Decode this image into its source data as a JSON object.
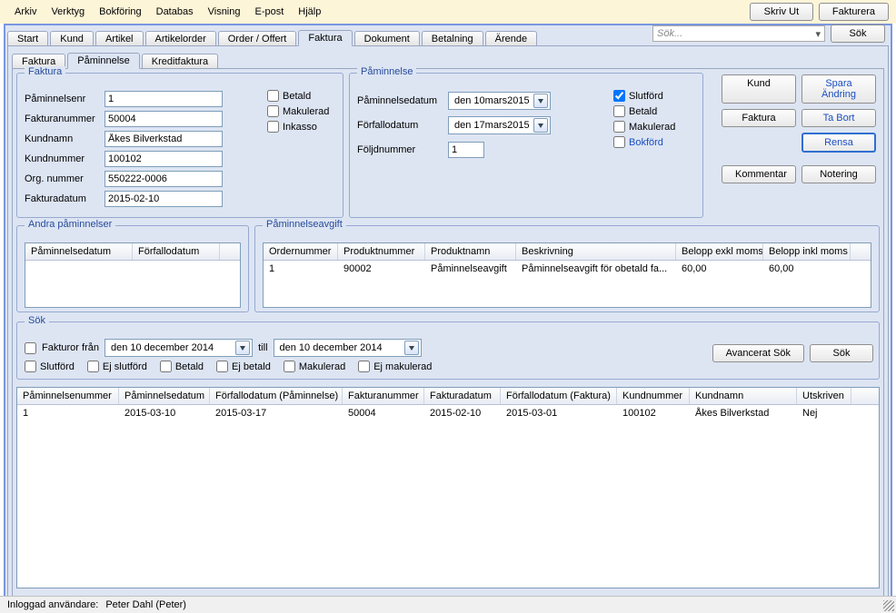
{
  "menu": [
    "Arkiv",
    "Verktyg",
    "Bokföring",
    "Databas",
    "Visning",
    "E-post",
    "Hjälp"
  ],
  "topButtons": {
    "print": "Skriv Ut",
    "invoice": "Fakturera"
  },
  "search": {
    "placeholder": "Sök...",
    "btn": "Sök"
  },
  "mainTabs": [
    "Start",
    "Kund",
    "Artikel",
    "Artikelorder",
    "Order / Offert",
    "Faktura",
    "Dokument",
    "Betalning",
    "Ärende"
  ],
  "mainActive": 5,
  "subTabs": [
    "Faktura",
    "Påminnelse",
    "Kreditfaktura"
  ],
  "subActive": 1,
  "fakturaGroup": {
    "title": "Faktura",
    "rows": {
      "paminnelseNr": {
        "lbl": "Påminnelsenr",
        "val": "1"
      },
      "fakturaNr": {
        "lbl": "Fakturanummer",
        "val": "50004"
      },
      "kundnamn": {
        "lbl": "Kundnamn",
        "val": "Åkes Bilverkstad"
      },
      "kundnummer": {
        "lbl": "Kundnummer",
        "val": "100102"
      },
      "orgnr": {
        "lbl": "Org. nummer",
        "val": "550222-0006"
      },
      "fakturadatum": {
        "lbl": "Fakturadatum",
        "val": "2015-02-10"
      }
    },
    "checks": {
      "betald": "Betald",
      "makulerad": "Makulerad",
      "inkasso": "Inkasso"
    }
  },
  "paminnelseGroup": {
    "title": "Påminnelse",
    "paminnelsedatum": {
      "lbl": "Påminnelsedatum",
      "d": "den 10",
      "m": "mars",
      "y": "2015"
    },
    "forfallodatum": {
      "lbl": "Förfallodatum",
      "d": "den 17",
      "m": "mars",
      "y": "2015"
    },
    "foljdnummer": {
      "lbl": "Följdnummer",
      "val": "1"
    },
    "checks": {
      "slutford": "Slutförd",
      "betald": "Betald",
      "makulerad": "Makulerad",
      "bokford": "Bokförd"
    },
    "checked": {
      "slutford": true
    }
  },
  "sideButtons": {
    "kund": "Kund",
    "sparaAndring": "Spara Ändring",
    "faktura": "Faktura",
    "taBort": "Ta Bort",
    "rensa": "Rensa",
    "kommentar": "Kommentar",
    "notering": "Notering"
  },
  "andra": {
    "title": "Andra påminnelser",
    "cols": [
      "Påminnelsedatum",
      "Förfallodatum"
    ]
  },
  "avgift": {
    "title": "Påminnelseavgift",
    "cols": [
      "Ordernummer",
      "Produktnummer",
      "Produktnamn",
      "Beskrivning",
      "Belopp exkl moms",
      "Belopp inkl moms"
    ],
    "row": [
      "1",
      "90002",
      "Påminnelseavgift",
      "Påminnelseavgift för obetald fa...",
      "60,00",
      "60,00"
    ]
  },
  "sok": {
    "title": "Sök",
    "fakturorFran": "Fakturor från",
    "from": "den 10 december 2014",
    "till": "till",
    "to": "den 10 december 2014",
    "checks": [
      "Slutförd",
      "Ej slutförd",
      "Betald",
      "Ej betald",
      "Makulerad",
      "Ej makulerad"
    ],
    "advBtn": "Avancerat Sök",
    "sokBtn": "Sök"
  },
  "results": {
    "cols": [
      "Påminnelsenummer",
      "Påminnelsedatum",
      "Förfallodatum (Påminnelse)",
      "Fakturanummer",
      "Fakturadatum",
      "Förfallodatum (Faktura)",
      "Kundnummer",
      "Kundnamn",
      "Utskriven"
    ],
    "row": [
      "1",
      "2015-03-10",
      "2015-03-17",
      "50004",
      "2015-02-10",
      "2015-03-01",
      "100102",
      "Åkes Bilverkstad",
      "Nej"
    ]
  },
  "footer": {
    "lbl": "Inloggad användare:",
    "user": "Peter Dahl (Peter)"
  }
}
